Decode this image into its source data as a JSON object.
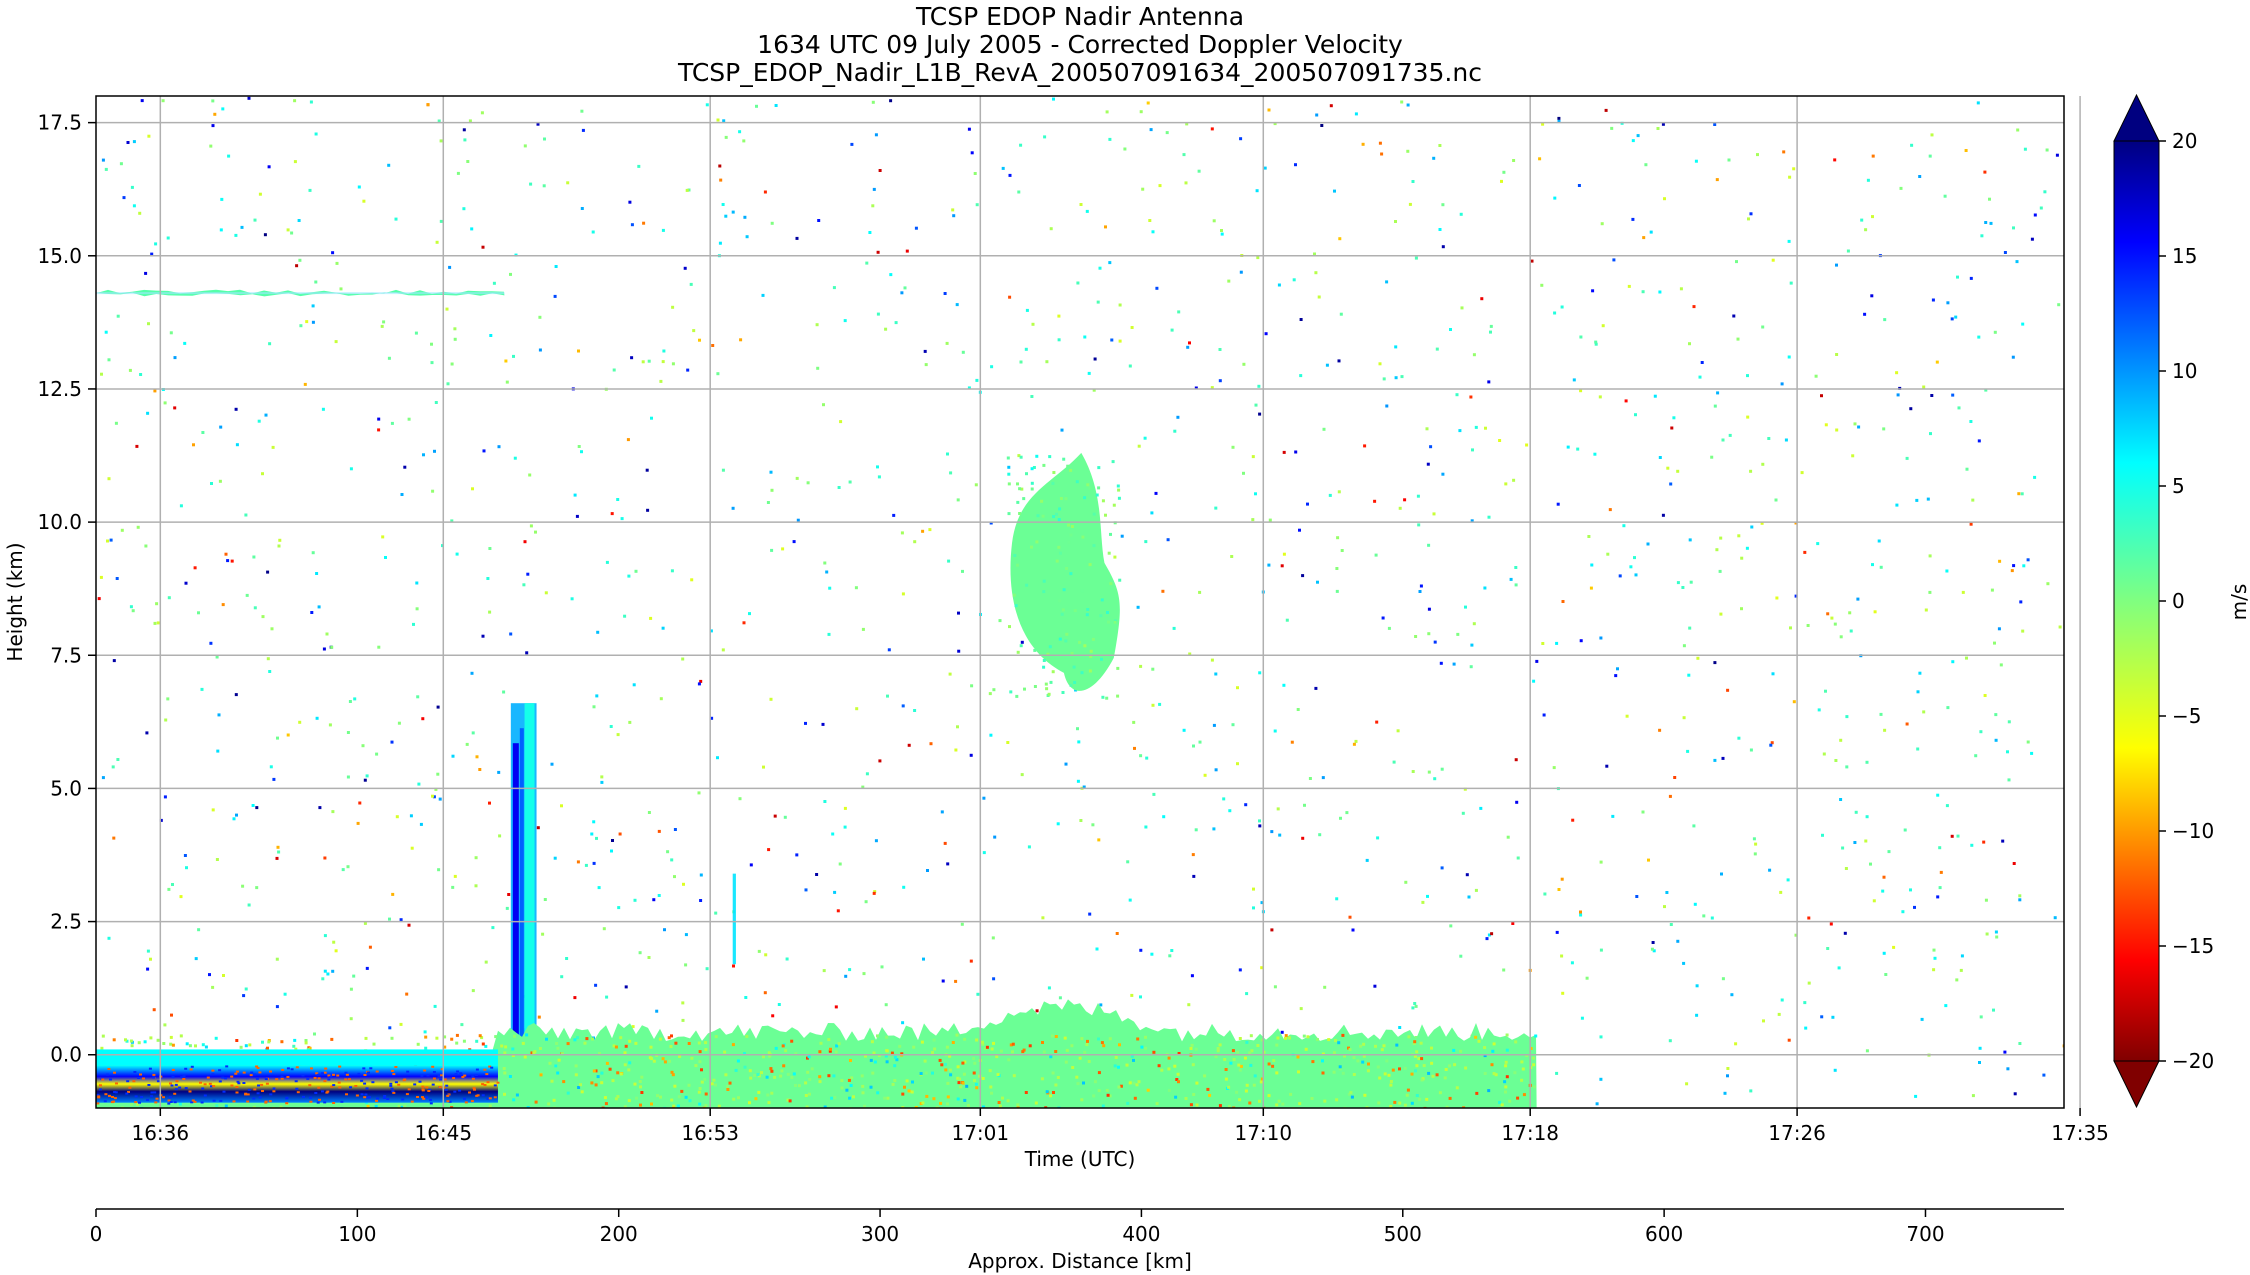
{
  "chart_data": {
    "type": "heatmap",
    "title_lines": [
      "TCSP EDOP Nadir Antenna",
      "1634 UTC 09 July 2005 - Corrected Doppler Velocity",
      "TCSP_EDOP_Nadir_L1B_RevA_200507091634_200507091735.nc"
    ],
    "xlabel": "Time (UTC)",
    "ylabel": "Height (km)",
    "x_ticks": [
      "16:36",
      "16:45",
      "16:53",
      "17:01",
      "17:10",
      "17:18",
      "17:26",
      "17:35"
    ],
    "x_tick_minutes": [
      2,
      10.8,
      19.1,
      27.5,
      36.3,
      44.6,
      52.9,
      61.7
    ],
    "x_range_minutes": [
      0,
      61.2
    ],
    "y_ticks": [
      "0.0",
      "2.5",
      "5.0",
      "7.5",
      "10.0",
      "12.5",
      "15.0",
      "17.5"
    ],
    "y_tick_values": [
      0,
      2.5,
      5,
      7.5,
      10,
      12.5,
      15,
      17.5
    ],
    "ylim": [
      -1,
      18
    ],
    "grid": true,
    "data_end_minutes": 44.8,
    "colorbar": {
      "label": "m/s",
      "range": [
        -20,
        20
      ],
      "ticks": [
        "20",
        "15",
        "10",
        "5",
        "0",
        "−10",
        "−15",
        "−20",
        "−5"
      ],
      "tick_values": [
        20,
        15,
        10,
        5,
        0,
        -10,
        -15,
        -20,
        -5
      ],
      "extend": "both",
      "colormap": "jet_r",
      "colors": [
        "#800000",
        "#ff0000",
        "#ff8000",
        "#ffff00",
        "#80ff80",
        "#00ffff",
        "#0080ff",
        "#0000ff",
        "#000080"
      ]
    },
    "distance_axis": {
      "xlabel": "Approx. Distance [km]",
      "ticks": [
        "0",
        "100",
        "200",
        "300",
        "400",
        "500",
        "600",
        "700"
      ],
      "tick_values": [
        0,
        100,
        200,
        300,
        400,
        500,
        600,
        700
      ],
      "range": [
        0,
        753
      ]
    },
    "features": [
      {
        "kind": "layer",
        "x": [
          0,
          12.7
        ],
        "y": [
          14.2,
          14.4
        ],
        "velocity": 2
      },
      {
        "kind": "cell",
        "x": [
          28.3,
          31.9
        ],
        "y": [
          6.7,
          11.3
        ],
        "velocity": 1
      },
      {
        "kind": "column",
        "x": [
          12.9,
          13.7
        ],
        "y": [
          0,
          6.6
        ],
        "velocity": 9
      },
      {
        "kind": "column",
        "x": [
          19.8,
          19.9
        ],
        "y": [
          1.7,
          3.4
        ],
        "velocity": 7
      },
      {
        "kind": "surface",
        "x": [
          0,
          44.8
        ],
        "y": [
          -1,
          0.7
        ],
        "velocity": 1
      },
      {
        "kind": "band",
        "x": [
          0,
          12.5
        ],
        "y": [
          -0.9,
          -0.2
        ],
        "velocity": 18
      }
    ]
  }
}
